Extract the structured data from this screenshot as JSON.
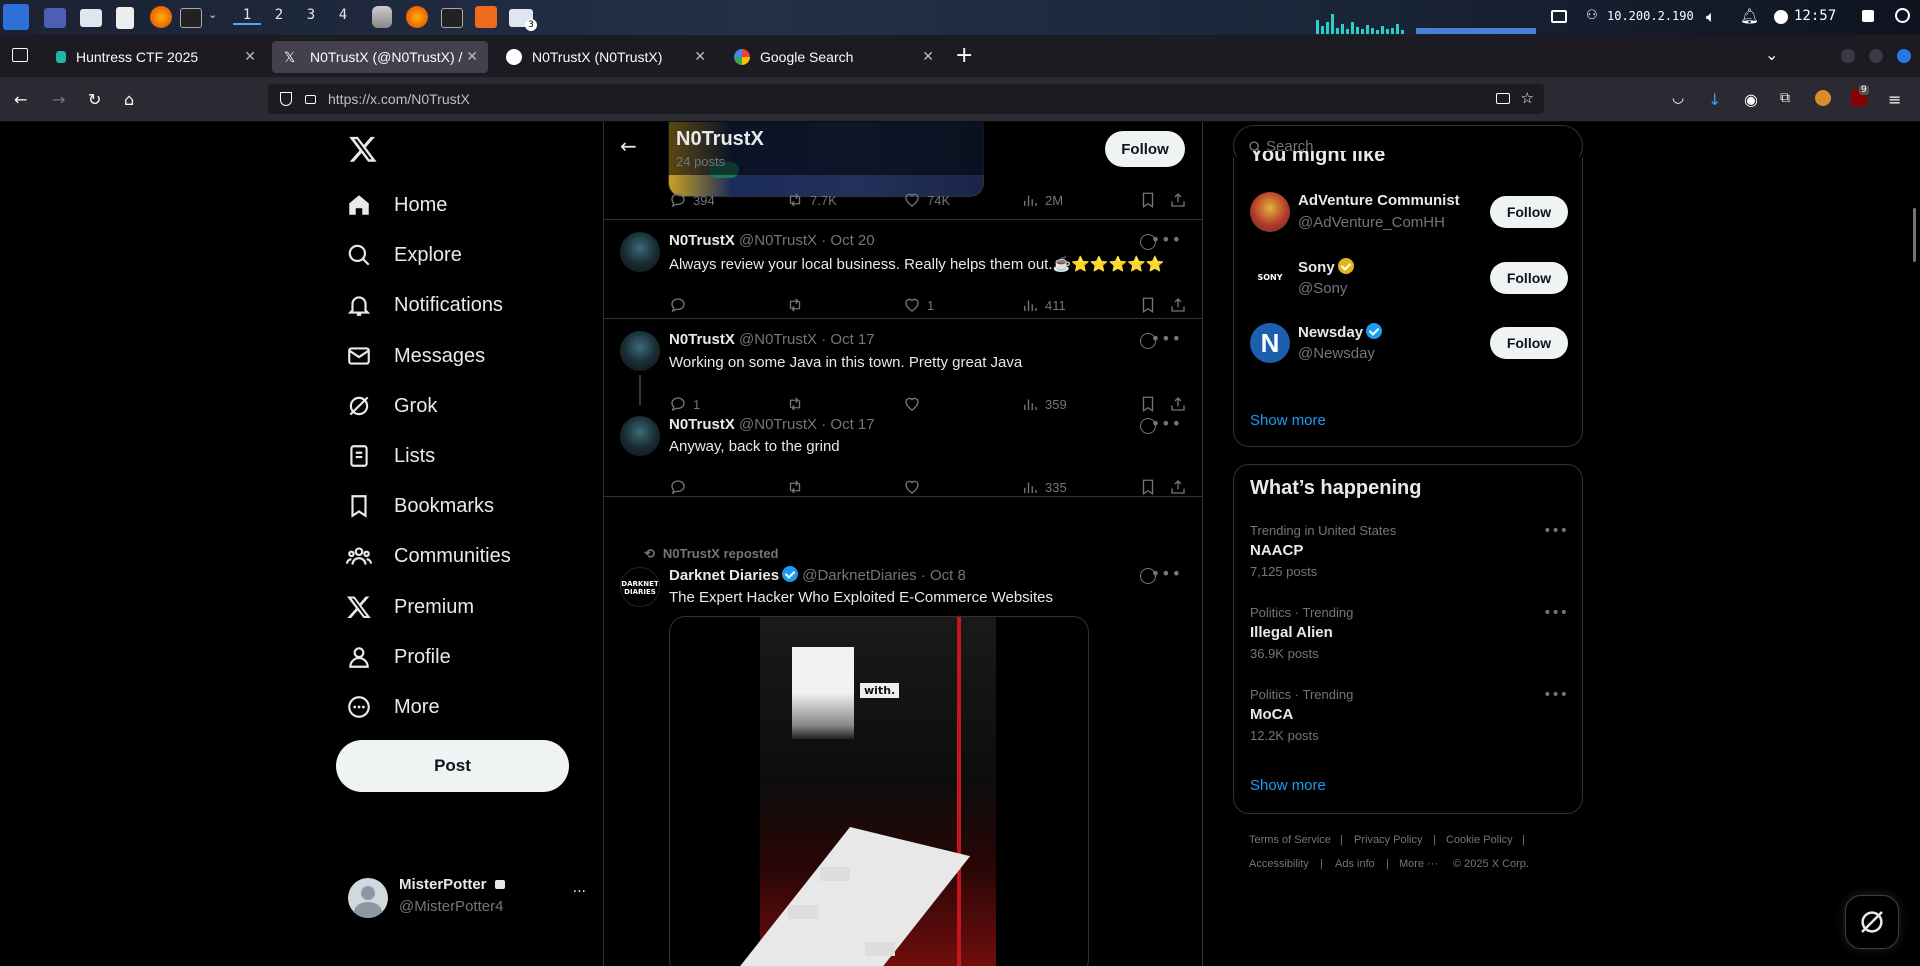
{
  "os": {
    "workspaces": [
      "1",
      "2",
      "3",
      "4"
    ],
    "ip": "10.200.2.190",
    "clock": "12:57",
    "badge": "3"
  },
  "browser": {
    "tabs": [
      {
        "title": "Huntress CTF 2025"
      },
      {
        "title": "N0TrustX (@N0TrustX) /"
      },
      {
        "title": "N0TrustX (N0TrustX)"
      },
      {
        "title": "Google Search"
      }
    ],
    "url": "https://x.com/N0TrustX",
    "ext_badge": "9"
  },
  "sidebar": {
    "items": [
      "Home",
      "Explore",
      "Notifications",
      "Messages",
      "Grok",
      "Lists",
      "Bookmarks",
      "Communities",
      "Premium",
      "Profile",
      "More"
    ],
    "post_label": "Post",
    "account_name": "MisterPotter",
    "account_handle": "@MisterPotter4",
    "account_menu": "···"
  },
  "header": {
    "name": "N0TrustX",
    "posts": "24 posts",
    "follow": "Follow"
  },
  "timeline": {
    "first_stats": {
      "replies": "394",
      "reposts": "7.7K",
      "likes": "74K",
      "views": "2M"
    },
    "tweets": [
      {
        "name": "N0TrustX",
        "handle": "@N0TrustX",
        "date": "· Oct 20",
        "text": "Always review your local business. Really helps them out.☕⭐⭐⭐⭐⭐",
        "replies": "",
        "likes": "1",
        "views": "411"
      },
      {
        "name": "N0TrustX",
        "handle": "@N0TrustX",
        "date": "· Oct 17",
        "text": "Working on some Java in this town. Pretty great Java",
        "replies": "1",
        "likes": "",
        "views": "359"
      },
      {
        "name": "N0TrustX",
        "handle": "@N0TrustX",
        "date": "· Oct 17",
        "text": "Anyway, back to the grind",
        "replies": "",
        "likes": "",
        "views": "335"
      }
    ],
    "repost": {
      "label": "N0TrustX reposted",
      "name": "Darknet Diaries",
      "handle": "@DarknetDiaries",
      "date": "· Oct 8",
      "text": "The Expert Hacker Who Exploited E-Commerce Websites",
      "avatar_text": "DARKNET DIARIES",
      "image_caption": "with."
    }
  },
  "search": {
    "placeholder": "Search"
  },
  "who_to_follow": {
    "title": "You might like",
    "accounts": [
      {
        "name": "AdVenture Communist",
        "handle": "@AdVenture_ComHH",
        "follow": "Follow"
      },
      {
        "name": "Sony",
        "handle": "@Sony",
        "follow": "Follow",
        "logo": "SONY"
      },
      {
        "name": "Newsday",
        "handle": "@Newsday",
        "follow": "Follow",
        "logo": "N"
      }
    ],
    "show_more": "Show more"
  },
  "trends": {
    "title": "What’s happening",
    "items": [
      {
        "context": "Trending in United States",
        "topic": "NAACP",
        "count": "7,125 posts"
      },
      {
        "context": "Politics · Trending",
        "topic": "Illegal Alien",
        "count": "36.9K posts"
      },
      {
        "context": "Politics · Trending",
        "topic": "MoCA",
        "count": "12.2K posts"
      }
    ],
    "show_more": "Show more"
  },
  "footer": {
    "links": [
      "Terms of Service",
      "|",
      "Privacy Policy",
      "|",
      "Cookie Policy",
      "|",
      "Accessibility",
      "|",
      "Ads info",
      "|",
      "More ···",
      "© 2025 X Corp."
    ]
  },
  "colors": {
    "accent": "#1d9bf0",
    "bg": "#000000",
    "border": "#2f3336",
    "muted": "#71767b"
  }
}
